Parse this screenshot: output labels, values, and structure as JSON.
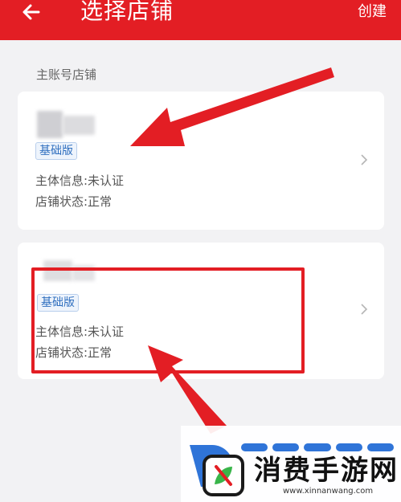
{
  "header": {
    "title": "选择店铺",
    "create_label": "创建",
    "back_icon": "arrow-left-icon"
  },
  "section": {
    "title": "主账号店铺"
  },
  "stores": [
    {
      "badge": "基础版",
      "subject_info": "主体信息:未认证",
      "store_status": "店铺状态:正常"
    },
    {
      "badge": "基础版",
      "subject_info": "主体信息:未认证",
      "store_status": "店铺状态:正常"
    }
  ],
  "watermark": {
    "title": "消费手游网",
    "url": "www.xinnanwang.com"
  },
  "colors": {
    "header": "#e31e24",
    "annotation": "#e31e24",
    "badge_text": "#2f6fbf"
  }
}
